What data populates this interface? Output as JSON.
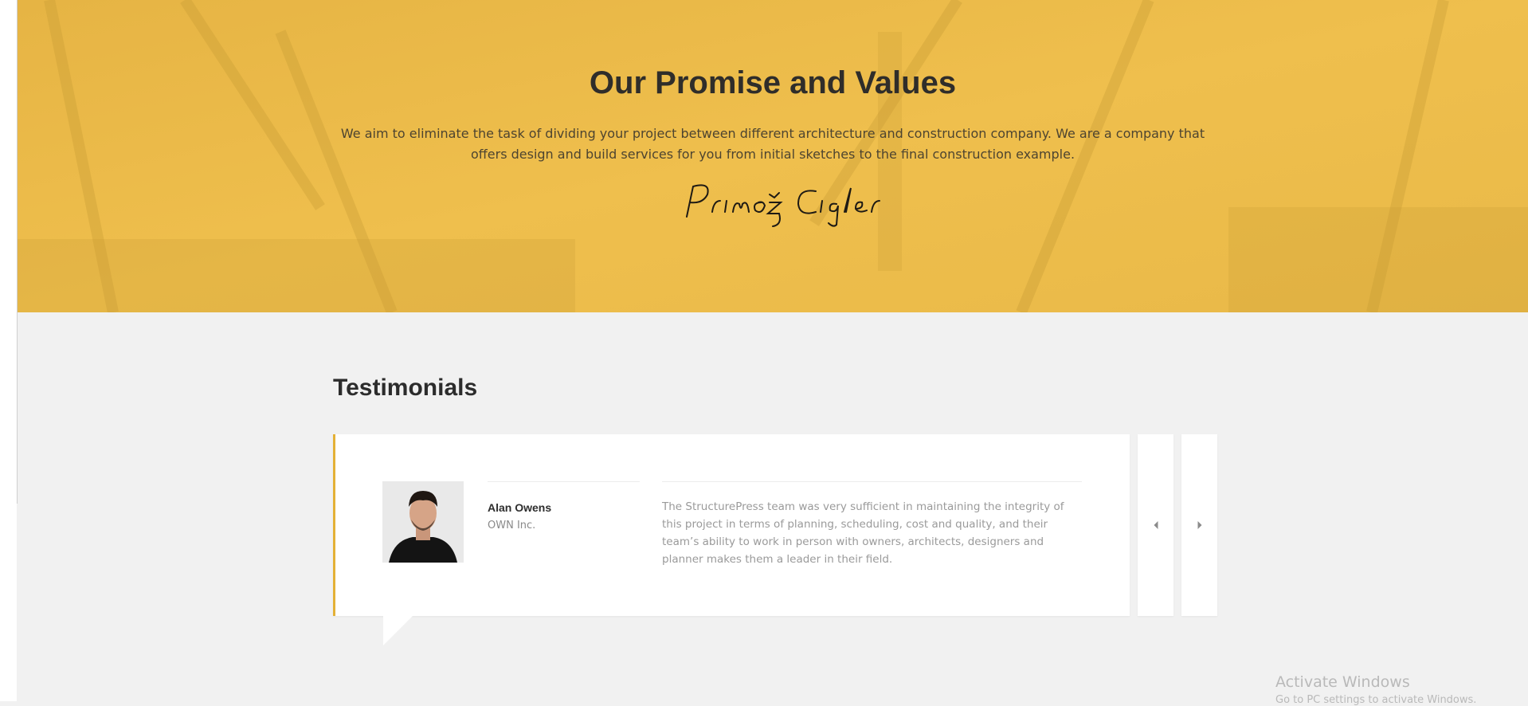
{
  "hero": {
    "title": "Our Promise and Values",
    "text": "We aim to eliminate the task of dividing your project between different architecture and construction company. We are a company that offers design and build services for you from initial sketches to the final construction example.",
    "signature": "Primož Cigler",
    "background_color": "#ebbb48"
  },
  "testimonials": {
    "title": "Testimonials",
    "accent_color": "#e4b136",
    "items": [
      {
        "name": "Alan Owens",
        "company": "OWN Inc.",
        "quote": "The StructurePress team was very sufficient in maintaining the integrity of this project in terms of planning, scheduling, cost and quality, and their team’s ability to work in person with owners, architects, designers and planner makes them a leader in their field."
      }
    ],
    "prev_icon": "caret-left-icon",
    "next_icon": "caret-right-icon"
  },
  "watermark": {
    "line1": "Activate Windows",
    "line2": "Go to PC settings to activate Windows."
  }
}
